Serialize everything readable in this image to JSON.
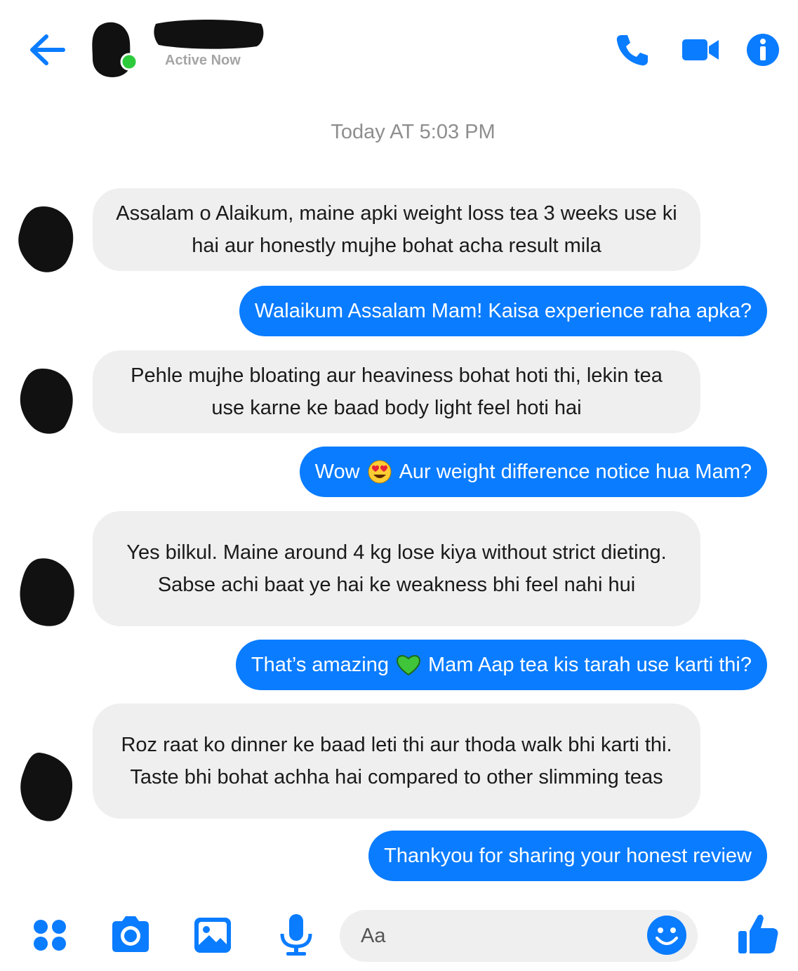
{
  "header": {
    "status_text": "Active Now",
    "accent_color": "#0a7cff",
    "online_color": "#2dcb3c",
    "icons": [
      "back-arrow-icon",
      "phone-icon",
      "video-camera-icon",
      "info-icon"
    ]
  },
  "conversation": {
    "timestamp": "Today AT 5:03 PM",
    "messages": [
      {
        "from": "contact",
        "text": "Assalam o Alaikum, maine apki weight loss tea 3 weeks use ki hai aur honestly mujhe bohat acha result mila"
      },
      {
        "from": "me",
        "text": "Walaikum Assalam Mam! Kaisa experience raha apka?"
      },
      {
        "from": "contact",
        "text": "Pehle mujhe bloating aur heaviness bohat hoti thi, lekin tea use karne ke baad body light feel hoti hai"
      },
      {
        "from": "me",
        "text_before": "Wow",
        "emoji": "heart-eyes-emoji",
        "text_after": "Aur weight difference notice hua Mam?"
      },
      {
        "from": "contact",
        "text": "Yes bilkul. Maine around 4 kg lose kiya without strict dieting. Sabse achi baat ye hai ke weakness bhi feel nahi hui"
      },
      {
        "from": "me",
        "text_before": "That’s amazing",
        "emoji": "green-heart-emoji",
        "text_after": "Mam Aap tea kis tarah use karti thi?"
      },
      {
        "from": "contact",
        "text": "Roz raat ko dinner ke baad leti thi aur thoda walk bhi karti thi. Taste bhi bohat achha hai compared to other slimming teas"
      },
      {
        "from": "me",
        "text": "Thankyou for sharing your honest review"
      }
    ]
  },
  "composer": {
    "placeholder": "Aa",
    "icons": [
      "menu-dots-icon",
      "camera-icon",
      "image-icon",
      "microphone-icon",
      "smiley-icon",
      "thumbs-up-icon"
    ]
  }
}
